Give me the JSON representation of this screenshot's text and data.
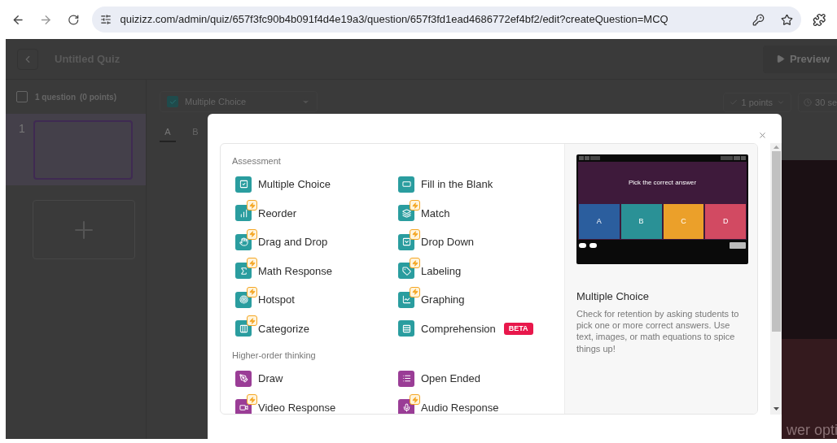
{
  "browser": {
    "url": "quizizz.com/admin/quiz/657f3fc90b4b091f4d4e19a3/question/657f3fd1ead4686772ef4bf2/edit?createQuestion=MCQ"
  },
  "header": {
    "title": "Untitled Quiz",
    "preview_button": "Preview"
  },
  "sidebar": {
    "select_all_checked": false,
    "count": "1 question",
    "points": "(0 points)",
    "questions": [
      {
        "number": "1",
        "selected": true
      }
    ]
  },
  "toolbar": {
    "question_type": "Multiple Choice",
    "points": "1 points",
    "timer": "30 se"
  },
  "answer_tabs": [
    {
      "label": "A",
      "selected": true
    },
    {
      "label": "B",
      "selected": false
    }
  ],
  "background_hint": "wer opti",
  "modal": {
    "sections": [
      {
        "title": "Assessment",
        "items": [
          {
            "label": "Multiple Choice",
            "color": "#2a9d9f",
            "premium": false
          },
          {
            "label": "Fill in the Blank",
            "color": "#2a9d9f",
            "premium": false
          },
          {
            "label": "Reorder",
            "color": "#2a9d9f",
            "premium": true
          },
          {
            "label": "Match",
            "color": "#2a9d9f",
            "premium": true
          },
          {
            "label": "Drag and Drop",
            "color": "#2a9d9f",
            "premium": true
          },
          {
            "label": "Drop Down",
            "color": "#2a9d9f",
            "premium": true
          },
          {
            "label": "Math Response",
            "color": "#2a9d9f",
            "premium": true
          },
          {
            "label": "Labeling",
            "color": "#2a9d9f",
            "premium": true
          },
          {
            "label": "Hotspot",
            "color": "#2a9d9f",
            "premium": true
          },
          {
            "label": "Graphing",
            "color": "#2a9d9f",
            "premium": true
          },
          {
            "label": "Categorize",
            "color": "#2a9d9f",
            "premium": true
          },
          {
            "label": "Comprehension",
            "color": "#2a9d9f",
            "premium": false,
            "tag": "BETA"
          }
        ]
      },
      {
        "title": "Higher-order thinking",
        "items": [
          {
            "label": "Draw",
            "color": "#9a3d96",
            "premium": false
          },
          {
            "label": "Open Ended",
            "color": "#9a3d96",
            "premium": false
          },
          {
            "label": "Video Response",
            "color": "#9a3d96",
            "premium": true
          },
          {
            "label": "Audio Response",
            "color": "#9a3d96",
            "premium": true
          }
        ]
      }
    ],
    "preview": {
      "prompt": "Pick the correct answer",
      "options": [
        {
          "label": "A",
          "color": "#2b5e9e"
        },
        {
          "label": "B",
          "color": "#2a9196"
        },
        {
          "label": "C",
          "color": "#eba02a"
        },
        {
          "label": "D",
          "color": "#d24a62"
        }
      ]
    },
    "detail": {
      "title": "Multiple Choice",
      "description": "Check for retention by asking students to pick one or more correct answers. Use text, images, or math equations to spice things up!"
    }
  }
}
